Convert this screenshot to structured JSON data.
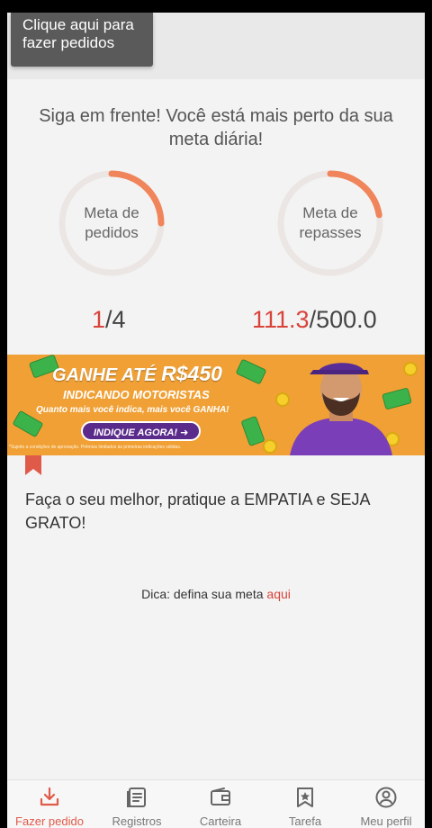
{
  "header": {
    "order_tooltip_line1": "Clique aqui para",
    "order_tooltip_line2": "fazer pedidos"
  },
  "motivation": {
    "line1": "Siga em frente! Você está mais perto da sua",
    "line2": "meta diária!"
  },
  "goals": {
    "orders": {
      "label_line1": "Meta de",
      "label_line2": "pedidos",
      "current": "1",
      "separator": "/",
      "target": "4",
      "progress": 0.25
    },
    "transfers": {
      "label_line1": "Meta de",
      "label_line2": "repasses",
      "current": "111.3",
      "separator": "/",
      "target": "500.0",
      "progress": 0.223
    }
  },
  "banner": {
    "headline_prefix": "GANHE ATÉ",
    "headline_amount": "R$450",
    "subtitle": "INDICANDO MOTORISTAS",
    "tagline": "Quanto mais você indica, mais você GANHA!",
    "cta": "INDIQUE AGORA! ➜",
    "fine_print": "*Sujeito a condições de aprovação. Prêmios limitados às primeiras indicações válidas."
  },
  "tip": {
    "text": "Faça o seu melhor, pratique a EMPATIA e SEJA GRATO!",
    "hint_prefix": "Dica: defina sua meta",
    "hint_link": "aqui"
  },
  "tabbar": {
    "items": [
      {
        "label": "Fazer pedido",
        "icon": "download-tray-icon",
        "active": true
      },
      {
        "label": "Registros",
        "icon": "records-icon",
        "active": false
      },
      {
        "label": "Carteira",
        "icon": "wallet-icon",
        "active": false
      },
      {
        "label": "Tarefa",
        "icon": "task-badge-icon",
        "active": false
      },
      {
        "label": "Meu perfil",
        "icon": "profile-icon",
        "active": false
      }
    ]
  },
  "colors": {
    "accent": "#e05a4a",
    "progress": "#f0845a",
    "banner_bg": "#f0a035",
    "cta_bg": "#5b2b8c"
  }
}
